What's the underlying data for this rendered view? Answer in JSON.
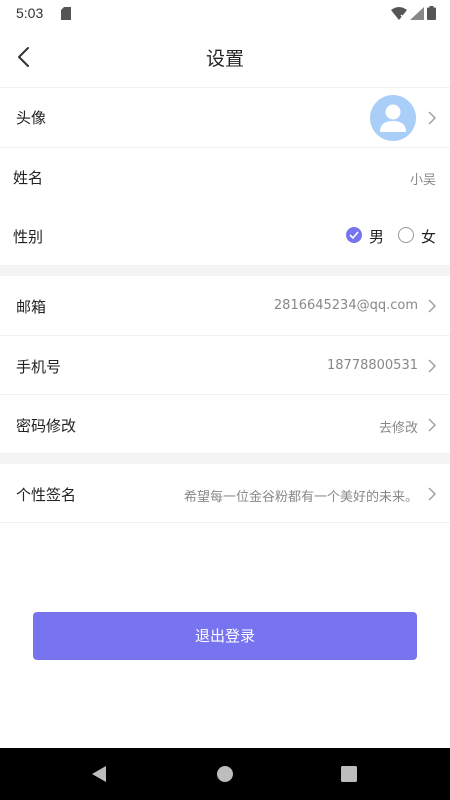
{
  "status_bar": {
    "time": "5:03"
  },
  "header": {
    "title": "设置"
  },
  "settings": {
    "avatar": {
      "label": "头像"
    },
    "name": {
      "label": "姓名",
      "value": "小吴"
    },
    "gender": {
      "label": "性别",
      "option_male": "男",
      "option_female": "女",
      "selected": "男"
    },
    "email": {
      "label": "邮箱",
      "value": "2816645234@qq.com"
    },
    "phone": {
      "label": "手机号",
      "value": "18778800531"
    },
    "password": {
      "label": "密码修改",
      "value": "去修改"
    },
    "signature": {
      "label": "个性签名",
      "value": "希望每一位金谷粉都有一个美好的未来。"
    }
  },
  "logout": {
    "label": "退出登录"
  },
  "colors": {
    "accent": "#7874f0",
    "avatar_bg": "#a9cff8",
    "divider": "#f4f4f4"
  },
  "icons": [
    "back-arrow-icon",
    "chevron-right-icon",
    "sd-card-icon",
    "wifi-icon",
    "cell-signal-icon",
    "battery-icon",
    "nav-back-icon",
    "nav-home-icon",
    "nav-recents-icon"
  ]
}
